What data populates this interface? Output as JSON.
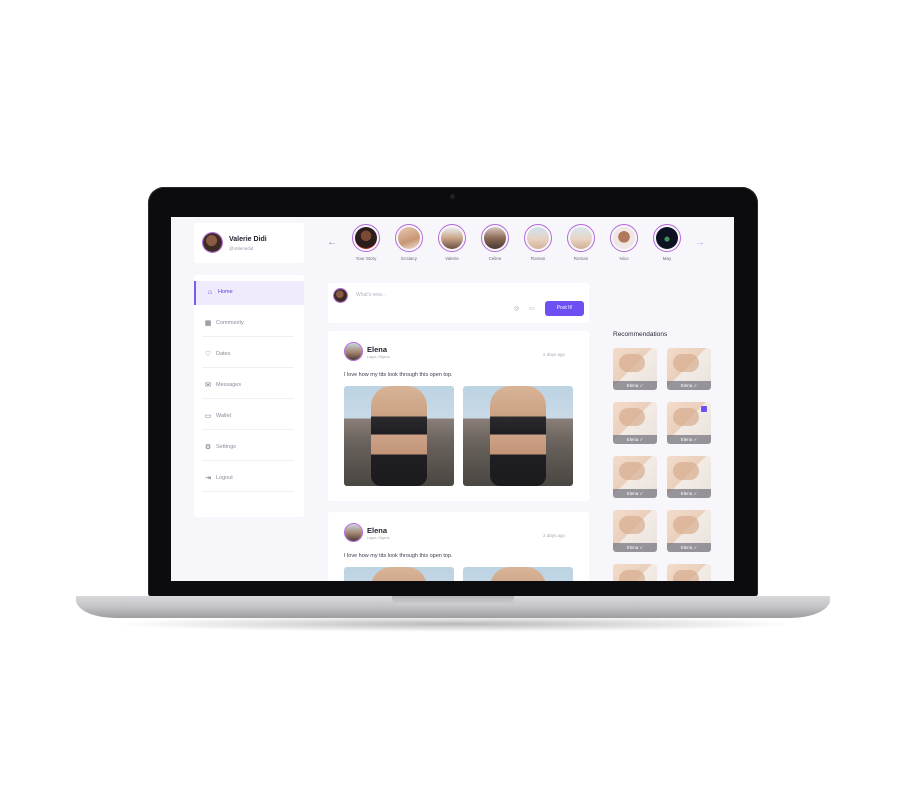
{
  "profile": {
    "name": "Valerie Didi",
    "handle": "@Valeriedid"
  },
  "nav": {
    "items": [
      {
        "label": "Home",
        "icon": "home-icon",
        "active": true
      },
      {
        "label": "Community",
        "icon": "community-icon"
      },
      {
        "label": "Dates",
        "icon": "heart-icon"
      },
      {
        "label": "Messages",
        "icon": "mail-icon"
      },
      {
        "label": "Wallet",
        "icon": "wallet-icon"
      },
      {
        "label": "Settings",
        "icon": "gear-icon"
      },
      {
        "label": "Logout",
        "icon": "logout-icon"
      }
    ]
  },
  "stories": {
    "prev_icon": "arrow-left-icon",
    "next_icon": "arrow-right-icon",
    "items": [
      "Your Story",
      "Ecstacy",
      "Valerie",
      "Celine",
      "Roman",
      "Roman",
      "Nico",
      "May"
    ]
  },
  "composer": {
    "placeholder": "What's new...",
    "camera_icon": "camera-icon",
    "video_icon": "video-icon",
    "post_label": "Post It!"
  },
  "posts": [
    {
      "author": "Elena",
      "location": "Lagos, Nigeria",
      "time": "2 days ago",
      "text": "I love how my tits look through this open top."
    },
    {
      "author": "Elena",
      "location": "Lagos, Nigeria",
      "time": "2 days ago",
      "text": "I love how my tits look through this open top."
    }
  ],
  "recommendations": {
    "title": "Recommendations",
    "items": [
      "Elena ✓",
      "Elena ✓",
      "Elena ✓",
      "Elena ✓",
      "Elena ✓",
      "Elena ✓",
      "Elena ✓",
      "Elena ✓"
    ]
  },
  "colors": {
    "accent": "#6e4ff2",
    "story_ring": "#b46ad8",
    "background": "#f7f7fb"
  }
}
